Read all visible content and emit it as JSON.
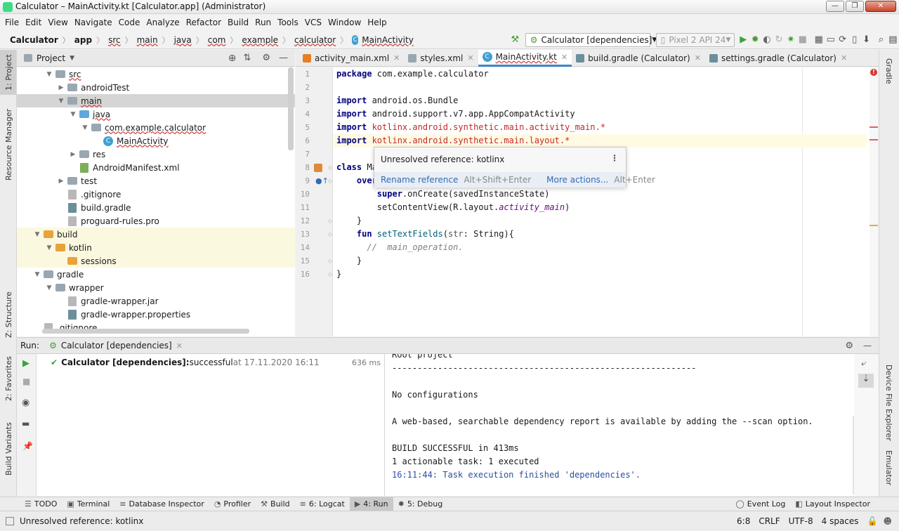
{
  "window": {
    "title": "Calculator – MainActivity.kt [Calculator.app] (Administrator)"
  },
  "menu": [
    "File",
    "Edit",
    "View",
    "Navigate",
    "Code",
    "Analyze",
    "Refactor",
    "Build",
    "Run",
    "Tools",
    "VCS",
    "Window",
    "Help"
  ],
  "breadcrumb": [
    "Calculator",
    "app",
    "src",
    "main",
    "java",
    "com",
    "example",
    "calculator",
    "MainActivity"
  ],
  "toolbar": {
    "run_config": "Calculator [dependencies]",
    "device": "Pixel 2 API 24"
  },
  "side_tabs": {
    "left_top": [
      "1: Project",
      "Resource Manager"
    ],
    "left_middle": [
      "Z: Structure"
    ],
    "left_bottom": [
      "2: Favorites",
      "Build Variants"
    ],
    "right_top": [
      "Gradle"
    ],
    "right_bottom": [
      "Device File Explorer",
      "Emulator"
    ]
  },
  "project": {
    "header": "Project",
    "nodes": [
      {
        "label": "src",
        "depth": 2,
        "arrow": "▼",
        "icon": "folder-g",
        "state": ""
      },
      {
        "label": "androidTest",
        "depth": 3,
        "arrow": "▶",
        "icon": "folder-g",
        "state": ""
      },
      {
        "label": "main",
        "depth": 3,
        "arrow": "▼",
        "icon": "folder-g",
        "state": "sel"
      },
      {
        "label": "java",
        "depth": 4,
        "arrow": "▼",
        "icon": "folder-b",
        "state": ""
      },
      {
        "label": "com.example.calculator",
        "depth": 5,
        "arrow": "▼",
        "icon": "folder-g",
        "state": ""
      },
      {
        "label": "MainActivity",
        "depth": 6,
        "arrow": "",
        "icon": "kt",
        "state": ""
      },
      {
        "label": "res",
        "depth": 4,
        "arrow": "▶",
        "icon": "folder-g",
        "state": ""
      },
      {
        "label": "AndroidManifest.xml",
        "depth": 4,
        "arrow": "",
        "icon": "file-mf",
        "state": ""
      },
      {
        "label": "test",
        "depth": 3,
        "arrow": "▶",
        "icon": "folder-g",
        "state": ""
      },
      {
        "label": ".gitignore",
        "depth": 3,
        "arrow": "",
        "icon": "file",
        "state": ""
      },
      {
        "label": "build.gradle",
        "depth": 3,
        "arrow": "",
        "icon": "file-gradle",
        "state": ""
      },
      {
        "label": "proguard-rules.pro",
        "depth": 3,
        "arrow": "",
        "icon": "file",
        "state": ""
      },
      {
        "label": "build",
        "depth": 1,
        "arrow": "▼",
        "icon": "folder-o",
        "state": "hl"
      },
      {
        "label": "kotlin",
        "depth": 2,
        "arrow": "▼",
        "icon": "folder-o",
        "state": "hl"
      },
      {
        "label": "sessions",
        "depth": 3,
        "arrow": "",
        "icon": "folder-o",
        "state": "hl"
      },
      {
        "label": "gradle",
        "depth": 1,
        "arrow": "▼",
        "icon": "folder-g",
        "state": ""
      },
      {
        "label": "wrapper",
        "depth": 2,
        "arrow": "▼",
        "icon": "folder-g",
        "state": ""
      },
      {
        "label": "gradle-wrapper.jar",
        "depth": 3,
        "arrow": "",
        "icon": "file",
        "state": ""
      },
      {
        "label": "gradle-wrapper.properties",
        "depth": 3,
        "arrow": "",
        "icon": "file-gradle",
        "state": ""
      },
      {
        "label": ".gitignore",
        "depth": 1,
        "arrow": "",
        "icon": "file",
        "state": ""
      }
    ]
  },
  "editor": {
    "tabs": [
      {
        "label": "activity_main.xml",
        "active": false
      },
      {
        "label": "styles.xml",
        "active": false
      },
      {
        "label": "MainActivity.kt",
        "active": true
      },
      {
        "label": "build.gradle (Calculator)",
        "active": false
      },
      {
        "label": "settings.gradle (Calculator)",
        "active": false
      }
    ],
    "line_numbers": [
      "1",
      "2",
      "3",
      "4",
      "5",
      "6",
      "7",
      "8",
      "9",
      "10",
      "11",
      "12",
      "13",
      "14",
      "15",
      "16"
    ],
    "code": {
      "l1_kw": "package",
      "l1_rest": " com.example.calculator",
      "l3_kw": "import",
      "l3_rest": " android.os.Bundle",
      "l4_kw": "import",
      "l4_rest": " android.support.v7.app.AppCompatActivity",
      "l5_kw": "import",
      "l5_err": " kotlinx",
      "l5_rest": ".android.synthetic.main.activity_main.*",
      "l6_kw": "import",
      "l6_err": " kotlinx",
      "l6_rest": ".android.synthetic.main.layout.*",
      "l8_kw": "class",
      "l8_rest": " Ma",
      "l9_kw": "    over",
      "l10_kw": "        super",
      "l10_rest": ".onCreate(savedInstanceState)",
      "l11_a": "        setContentView(R.layout.",
      "l11_it": "activity_main",
      "l11_b": ")",
      "l12": "    }",
      "l13_kw": "    fun",
      "l13_fn": " setTextFields",
      "l13_a": "(",
      "l13_par": "str",
      "l13_b": ": String){",
      "l14": "      //  main_operation.",
      "l15": "    }",
      "l16": "}"
    },
    "popup": {
      "message": "Unresolved reference: kotlinx",
      "action1": "Rename reference",
      "hint1": "Alt+Shift+Enter",
      "action2": "More actions...",
      "hint2": "Alt+Enter"
    }
  },
  "run": {
    "label": "Run:",
    "tab": "Calculator [dependencies]",
    "item_name": "Calculator [dependencies]:",
    "item_status": " successful",
    "item_time": " at 17.11.2020 16:11",
    "item_duration": "636 ms",
    "console": [
      "Root project",
      "------------------------------------------------------------",
      "",
      "No configurations",
      "",
      "A web-based, searchable dependency report is available by adding the --scan option.",
      "",
      "BUILD SUCCESSFUL in 413ms",
      "1 actionable task: 1 executed",
      "16:11:44: Task execution finished 'dependencies'."
    ]
  },
  "bottom_tabs": [
    {
      "label": "TODO",
      "icon": "☰",
      "active": false
    },
    {
      "label": "Terminal",
      "icon": "▣",
      "active": false
    },
    {
      "label": "Database Inspector",
      "icon": "≡",
      "active": false
    },
    {
      "label": "Profiler",
      "icon": "◔",
      "active": false
    },
    {
      "label": "Build",
      "icon": "⚒",
      "active": false
    },
    {
      "label": "6: Logcat",
      "icon": "≡",
      "active": false
    },
    {
      "label": "4: Run",
      "icon": "▶",
      "active": true
    },
    {
      "label": "5: Debug",
      "icon": "✹",
      "active": false
    }
  ],
  "bottom_right_tabs": [
    {
      "label": "Event Log",
      "icon": "◯"
    },
    {
      "label": "Layout Inspector",
      "icon": "◧"
    }
  ],
  "status": {
    "message": "Unresolved reference: kotlinx",
    "position": "6:8",
    "line_sep": "CRLF",
    "encoding": "UTF-8",
    "indent": "4 spaces"
  }
}
